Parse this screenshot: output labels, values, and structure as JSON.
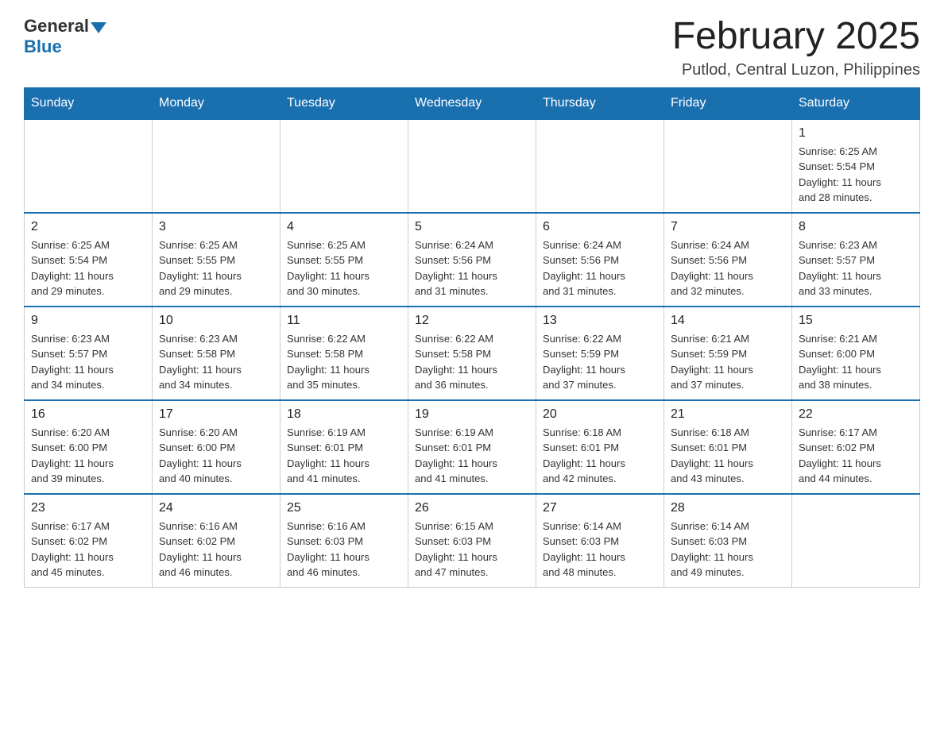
{
  "header": {
    "logo_general": "General",
    "logo_blue": "Blue",
    "month_title": "February 2025",
    "location": "Putlod, Central Luzon, Philippines"
  },
  "weekdays": [
    "Sunday",
    "Monday",
    "Tuesday",
    "Wednesday",
    "Thursday",
    "Friday",
    "Saturday"
  ],
  "weeks": [
    [
      {
        "day": "",
        "info": ""
      },
      {
        "day": "",
        "info": ""
      },
      {
        "day": "",
        "info": ""
      },
      {
        "day": "",
        "info": ""
      },
      {
        "day": "",
        "info": ""
      },
      {
        "day": "",
        "info": ""
      },
      {
        "day": "1",
        "info": "Sunrise: 6:25 AM\nSunset: 5:54 PM\nDaylight: 11 hours\nand 28 minutes."
      }
    ],
    [
      {
        "day": "2",
        "info": "Sunrise: 6:25 AM\nSunset: 5:54 PM\nDaylight: 11 hours\nand 29 minutes."
      },
      {
        "day": "3",
        "info": "Sunrise: 6:25 AM\nSunset: 5:55 PM\nDaylight: 11 hours\nand 29 minutes."
      },
      {
        "day": "4",
        "info": "Sunrise: 6:25 AM\nSunset: 5:55 PM\nDaylight: 11 hours\nand 30 minutes."
      },
      {
        "day": "5",
        "info": "Sunrise: 6:24 AM\nSunset: 5:56 PM\nDaylight: 11 hours\nand 31 minutes."
      },
      {
        "day": "6",
        "info": "Sunrise: 6:24 AM\nSunset: 5:56 PM\nDaylight: 11 hours\nand 31 minutes."
      },
      {
        "day": "7",
        "info": "Sunrise: 6:24 AM\nSunset: 5:56 PM\nDaylight: 11 hours\nand 32 minutes."
      },
      {
        "day": "8",
        "info": "Sunrise: 6:23 AM\nSunset: 5:57 PM\nDaylight: 11 hours\nand 33 minutes."
      }
    ],
    [
      {
        "day": "9",
        "info": "Sunrise: 6:23 AM\nSunset: 5:57 PM\nDaylight: 11 hours\nand 34 minutes."
      },
      {
        "day": "10",
        "info": "Sunrise: 6:23 AM\nSunset: 5:58 PM\nDaylight: 11 hours\nand 34 minutes."
      },
      {
        "day": "11",
        "info": "Sunrise: 6:22 AM\nSunset: 5:58 PM\nDaylight: 11 hours\nand 35 minutes."
      },
      {
        "day": "12",
        "info": "Sunrise: 6:22 AM\nSunset: 5:58 PM\nDaylight: 11 hours\nand 36 minutes."
      },
      {
        "day": "13",
        "info": "Sunrise: 6:22 AM\nSunset: 5:59 PM\nDaylight: 11 hours\nand 37 minutes."
      },
      {
        "day": "14",
        "info": "Sunrise: 6:21 AM\nSunset: 5:59 PM\nDaylight: 11 hours\nand 37 minutes."
      },
      {
        "day": "15",
        "info": "Sunrise: 6:21 AM\nSunset: 6:00 PM\nDaylight: 11 hours\nand 38 minutes."
      }
    ],
    [
      {
        "day": "16",
        "info": "Sunrise: 6:20 AM\nSunset: 6:00 PM\nDaylight: 11 hours\nand 39 minutes."
      },
      {
        "day": "17",
        "info": "Sunrise: 6:20 AM\nSunset: 6:00 PM\nDaylight: 11 hours\nand 40 minutes."
      },
      {
        "day": "18",
        "info": "Sunrise: 6:19 AM\nSunset: 6:01 PM\nDaylight: 11 hours\nand 41 minutes."
      },
      {
        "day": "19",
        "info": "Sunrise: 6:19 AM\nSunset: 6:01 PM\nDaylight: 11 hours\nand 41 minutes."
      },
      {
        "day": "20",
        "info": "Sunrise: 6:18 AM\nSunset: 6:01 PM\nDaylight: 11 hours\nand 42 minutes."
      },
      {
        "day": "21",
        "info": "Sunrise: 6:18 AM\nSunset: 6:01 PM\nDaylight: 11 hours\nand 43 minutes."
      },
      {
        "day": "22",
        "info": "Sunrise: 6:17 AM\nSunset: 6:02 PM\nDaylight: 11 hours\nand 44 minutes."
      }
    ],
    [
      {
        "day": "23",
        "info": "Sunrise: 6:17 AM\nSunset: 6:02 PM\nDaylight: 11 hours\nand 45 minutes."
      },
      {
        "day": "24",
        "info": "Sunrise: 6:16 AM\nSunset: 6:02 PM\nDaylight: 11 hours\nand 46 minutes."
      },
      {
        "day": "25",
        "info": "Sunrise: 6:16 AM\nSunset: 6:03 PM\nDaylight: 11 hours\nand 46 minutes."
      },
      {
        "day": "26",
        "info": "Sunrise: 6:15 AM\nSunset: 6:03 PM\nDaylight: 11 hours\nand 47 minutes."
      },
      {
        "day": "27",
        "info": "Sunrise: 6:14 AM\nSunset: 6:03 PM\nDaylight: 11 hours\nand 48 minutes."
      },
      {
        "day": "28",
        "info": "Sunrise: 6:14 AM\nSunset: 6:03 PM\nDaylight: 11 hours\nand 49 minutes."
      },
      {
        "day": "",
        "info": ""
      }
    ]
  ]
}
